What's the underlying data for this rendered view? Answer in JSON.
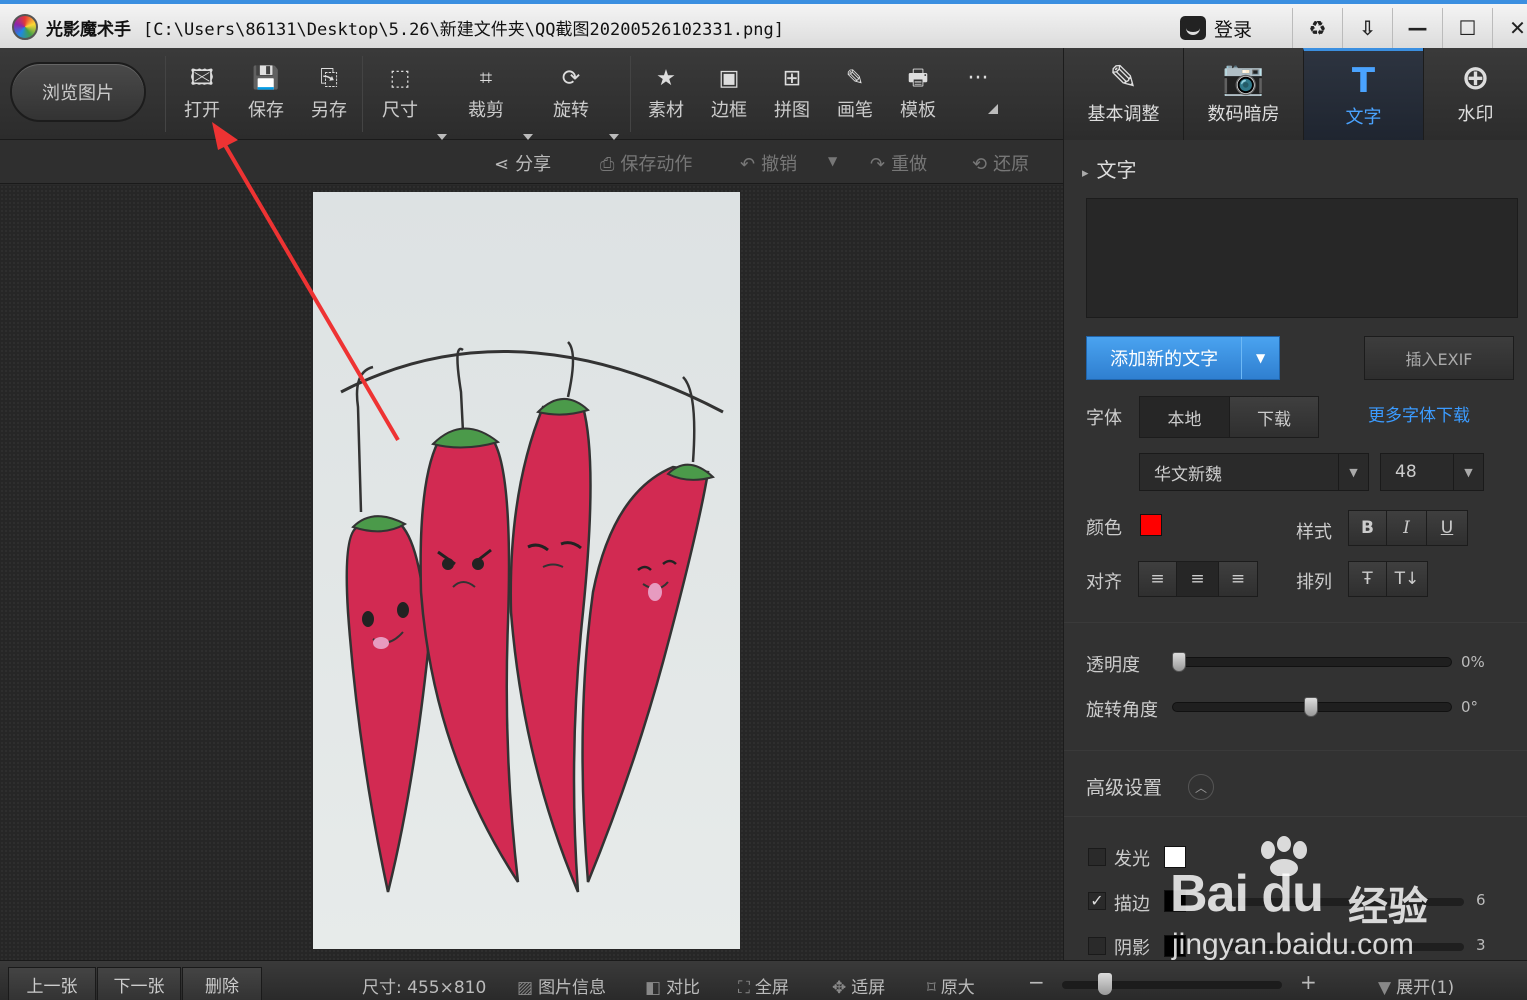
{
  "titlebar": {
    "app_name": "光影魔术手",
    "file_path": "[C:\\Users\\86131\\Desktop\\5.26\\新建文件夹\\QQ截图20200526102331.png]",
    "login_label": "登录",
    "buttons": [
      "♻",
      "⇩",
      "—",
      "☐",
      "✕"
    ]
  },
  "toolbar": {
    "browse_label": "浏览图片",
    "tools": [
      {
        "label": "打开",
        "icon": "🖾"
      },
      {
        "label": "保存",
        "icon": "💾"
      },
      {
        "label": "另存",
        "icon": "⎘"
      },
      {
        "label": "尺寸",
        "icon": "⬚"
      },
      {
        "label": "裁剪",
        "icon": "⌗"
      },
      {
        "label": "旋转",
        "icon": "⟳"
      },
      {
        "label": "素材",
        "icon": "★"
      },
      {
        "label": "边框",
        "icon": "▣"
      },
      {
        "label": "拼图",
        "icon": "⊞"
      },
      {
        "label": "画笔",
        "icon": "✎"
      },
      {
        "label": "模板",
        "icon": "🖶"
      }
    ],
    "more_icon": "···"
  },
  "tabs": [
    {
      "label": "基本调整",
      "icon": "✎"
    },
    {
      "label": "数码暗房",
      "icon": "📷"
    },
    {
      "label": "文字",
      "icon": "T"
    },
    {
      "label": "水印",
      "icon": "⊕"
    }
  ],
  "actionbar": {
    "share": "分享",
    "save_action": "保存动作",
    "undo": "撤销",
    "redo": "重做",
    "restore": "还原"
  },
  "panel": {
    "section_title": "文字",
    "add_text_label": "添加新的文字",
    "insert_exif_label": "插入EXIF",
    "font_label": "字体",
    "font_tabs": [
      "本地",
      "下载"
    ],
    "more_fonts": "更多字体下载",
    "font_name": "华文新魏",
    "font_size": "48",
    "color_label": "颜色",
    "text_color": "#ff0000",
    "style_label": "样式",
    "style_buttons": [
      "B",
      "I",
      "U"
    ],
    "align_label": "对齐",
    "align_buttons": [
      "≡",
      "≡",
      "≡"
    ],
    "arrange_label": "排列",
    "arrange_buttons": [
      "Ŧ",
      "T↓"
    ],
    "opacity_label": "透明度",
    "opacity_value": "0%",
    "rotation_label": "旋转角度",
    "rotation_value": "0°",
    "advanced_label": "高级设置",
    "glow_label": "发光",
    "stroke_label": "描边",
    "stroke_value": "6",
    "shadow_label": "阴影",
    "shadow_value": "3"
  },
  "statusbar": {
    "prev": "上一张",
    "next": "下一张",
    "delete": "删除",
    "size_text": "尺寸: 455×810",
    "info": "图片信息",
    "compare": "对比",
    "fullscreen": "全屏",
    "fit": "适屏",
    "original": "原大",
    "zoom_minus": "−",
    "zoom_plus": "+",
    "expand": "展开(1)"
  },
  "watermark": {
    "brand": "Bai du",
    "cn": "经验",
    "url": "jingyan.baidu.com"
  }
}
